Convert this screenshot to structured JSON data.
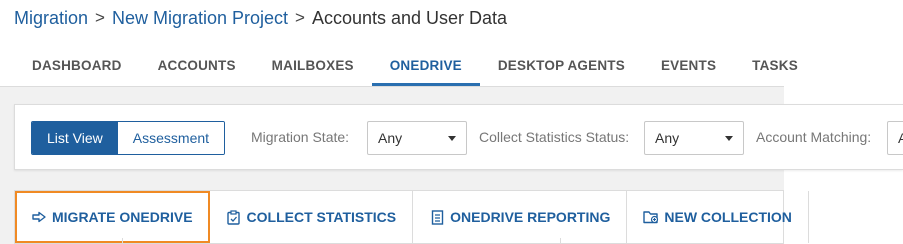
{
  "breadcrumb": {
    "items": [
      "Migration",
      "New Migration Project"
    ],
    "current": "Accounts and User Data",
    "separator": ">"
  },
  "tabs": [
    {
      "label": "DASHBOARD",
      "active": false
    },
    {
      "label": "ACCOUNTS",
      "active": false
    },
    {
      "label": "MAILBOXES",
      "active": false
    },
    {
      "label": "ONEDRIVE",
      "active": true
    },
    {
      "label": "DESKTOP AGENTS",
      "active": false
    },
    {
      "label": "EVENTS",
      "active": false
    },
    {
      "label": "TASKS",
      "active": false
    }
  ],
  "view_toggle": {
    "list_view": "List View",
    "assessment": "Assessment",
    "selected": "List View"
  },
  "filters": {
    "migration_state": {
      "label": "Migration State:",
      "value": "Any"
    },
    "collect_statistics_status": {
      "label": "Collect Statistics Status:",
      "value": "Any"
    },
    "account_matching": {
      "label": "Account Matching:",
      "value": "A"
    }
  },
  "actions": [
    {
      "label": "MIGRATE ONEDRIVE",
      "icon": "migrate-arrow-icon",
      "highlighted": true
    },
    {
      "label": "COLLECT STATISTICS",
      "icon": "clipboard-icon",
      "highlighted": false
    },
    {
      "label": "ONEDRIVE REPORTING",
      "icon": "report-icon",
      "highlighted": false
    },
    {
      "label": "NEW COLLECTION",
      "icon": "folder-add-icon",
      "highlighted": false
    }
  ],
  "colors": {
    "accent": "#1f5f9e",
    "highlight": "#f08a24",
    "background": "#f1f1f1"
  }
}
